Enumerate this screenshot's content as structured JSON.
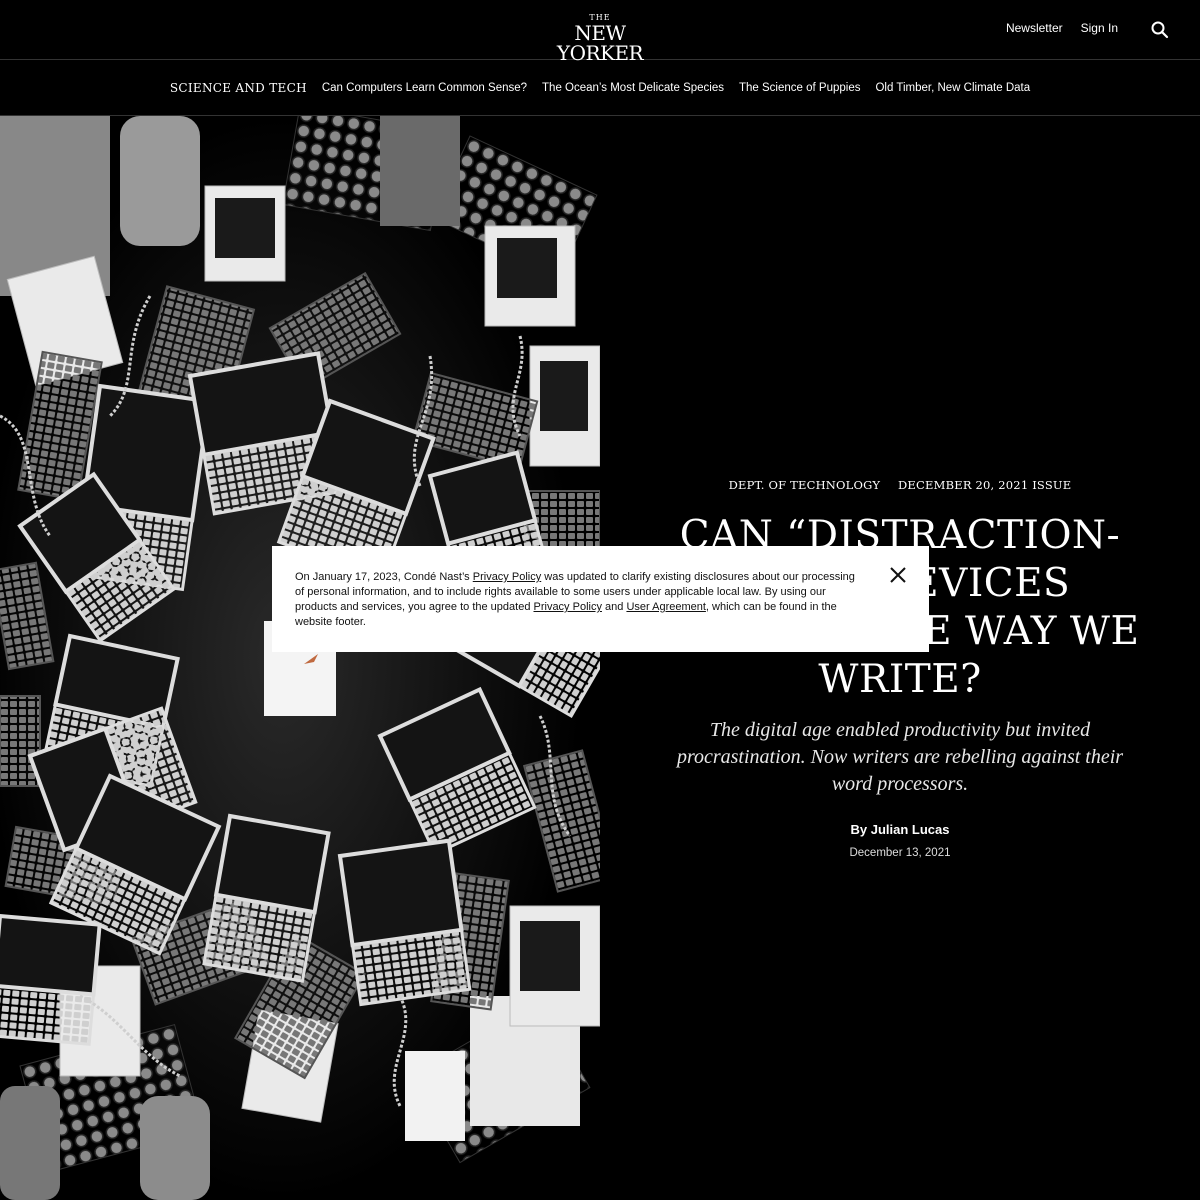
{
  "header": {
    "logo_the": "THE",
    "logo_name": "NEW YORKER",
    "newsletter_label": "Newsletter",
    "signin_label": "Sign In",
    "search_icon": "search-icon"
  },
  "subnav": {
    "section_label": "SCIENCE AND TECH",
    "links": [
      "Can Computers Learn Common Sense?",
      "The Ocean’s Most Delicate Species",
      "The Science of Puppies",
      "Old Timber, New Climate Data"
    ]
  },
  "article": {
    "rubric": "DEPT. OF TECHNOLOGY",
    "issue": "DECEMBER 20, 2021 ISSUE",
    "headline_line1": "CAN “DISTRACTION-",
    "headline_line2": "FREE” DEVICES",
    "headline_line3": "CHANGE THE WAY WE",
    "headline_line4": "WRITE?",
    "dek": "The digital age enabled productivity but invited procrastination. Now writers are rebelling against their word processors.",
    "by_label": "By",
    "author": "Julian Lucas",
    "date": "December 13, 2021",
    "image_icon": "computers-and-typewriters-illustration"
  },
  "privacy_banner": {
    "text_1": "On January 17, 2023, Condé Nast’s ",
    "link_privacy_1": "Privacy Policy",
    "text_2": " was updated to clarify existing disclosures about our processing of personal information, and to include rights available to some users under applicable local law. By using our products and services, you agree to the updated ",
    "link_privacy_2": "Privacy Policy",
    "text_3": " and ",
    "link_user_agreement": "User Agreement",
    "text_4": ", which can be found in the website footer.",
    "close_icon": "close-icon"
  },
  "colors": {
    "background": "#000000",
    "text": "#ffffff",
    "banner_bg": "#ffffff",
    "banner_text": "#111111"
  }
}
